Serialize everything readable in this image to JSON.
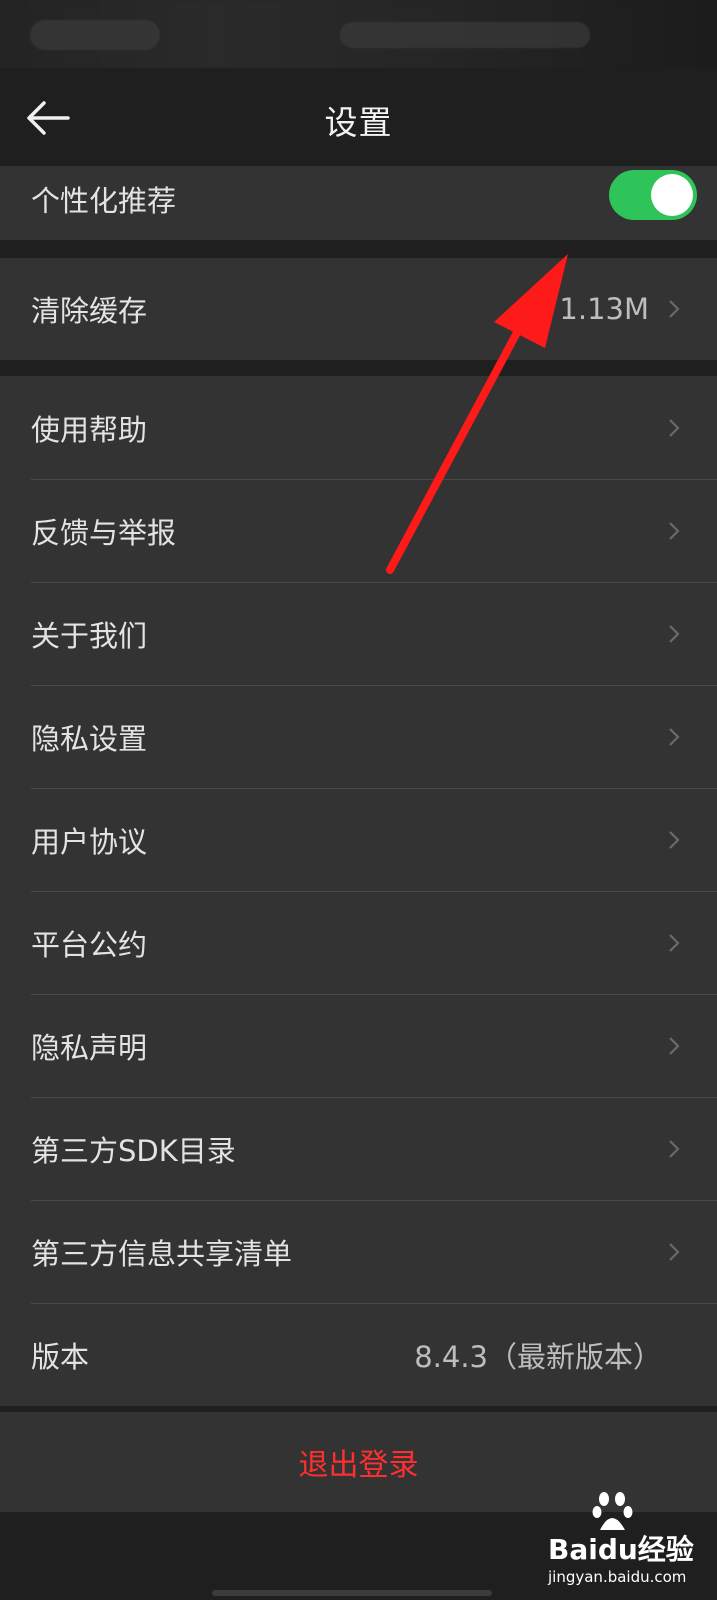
{
  "header": {
    "title": "设置"
  },
  "personalized": {
    "label": "个性化推荐",
    "enabled": true
  },
  "cache": {
    "label": "清除缓存",
    "value": "1.13M"
  },
  "menu": [
    {
      "label": "使用帮助"
    },
    {
      "label": "反馈与举报"
    },
    {
      "label": "关于我们"
    },
    {
      "label": "隐私设置"
    },
    {
      "label": "用户协议"
    },
    {
      "label": "平台公约"
    },
    {
      "label": "隐私声明"
    },
    {
      "label": "第三方SDK目录"
    },
    {
      "label": "第三方信息共享清单"
    }
  ],
  "version": {
    "label": "版本",
    "value": "8.4.3（最新版本）"
  },
  "logout": {
    "label": "退出登录"
  },
  "watermark": {
    "brand": "Baidu经验",
    "url": "jingyan.baidu.com"
  },
  "colors": {
    "toggle_on": "#2fc45a",
    "logout_text": "#ff2f2f",
    "arrow": "#ff1a1a"
  }
}
